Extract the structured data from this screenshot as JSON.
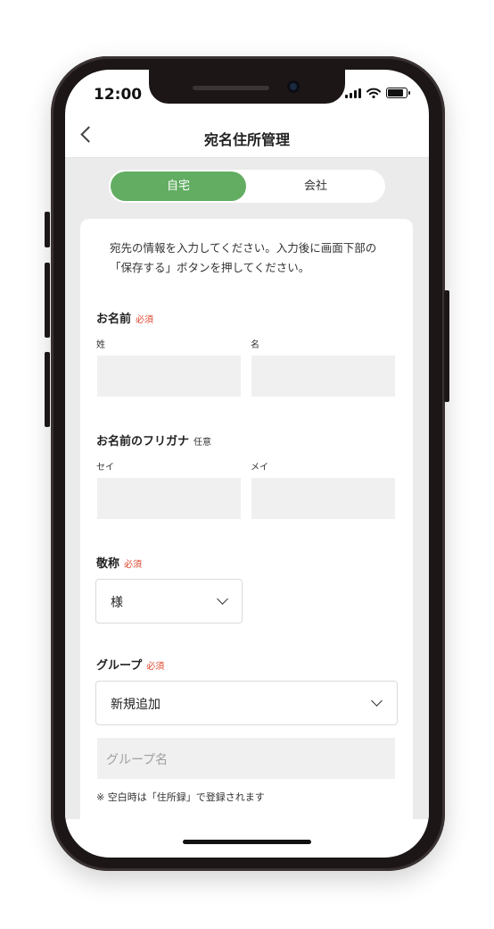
{
  "status_bar": {
    "time": "12:00"
  },
  "header": {
    "title": "宛名住所管理"
  },
  "tabs": [
    {
      "label": "自宅",
      "active": true
    },
    {
      "label": "会社",
      "active": false
    }
  ],
  "intro_text": "宛先の情報を入力してください。入力後に画面下部の「保存する」ボタンを押してください。",
  "name_section": {
    "label": "お名前",
    "badge": "必須",
    "last_label": "姓",
    "first_label": "名"
  },
  "kana_section": {
    "label": "お名前のフリガナ",
    "badge": "任意",
    "last_label": "セイ",
    "first_label": "メイ"
  },
  "honorific_section": {
    "label": "敬称",
    "badge": "必須",
    "value": "様"
  },
  "group_section": {
    "label": "グループ",
    "badge": "必須",
    "value": "新規追加",
    "group_name_placeholder": "グループ名",
    "note": "※ 空白時は「住所録」で登録されます"
  },
  "colors": {
    "accent": "#62ad62",
    "required": "#e0442c",
    "background": "#ebebeb"
  }
}
